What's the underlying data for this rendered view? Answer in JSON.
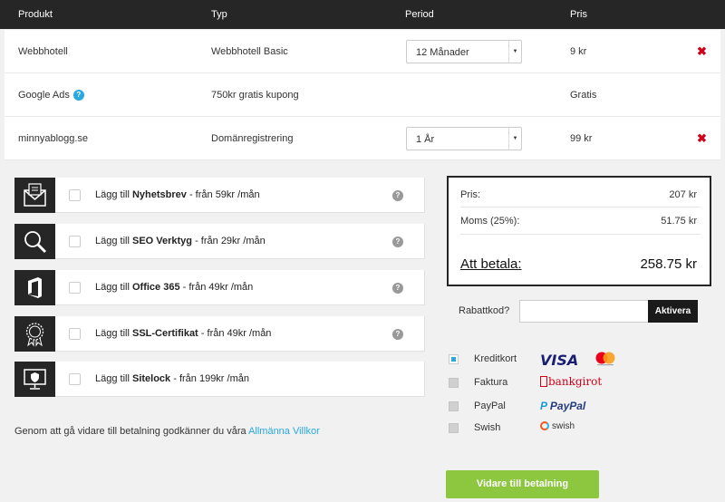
{
  "table": {
    "headers": [
      "Produkt",
      "Typ",
      "Period",
      "Pris"
    ],
    "rows": [
      {
        "product": "Webbhotell",
        "type": "Webbhotell Basic",
        "period": "12 Månader",
        "price": "9 kr"
      },
      {
        "product": "Google Ads",
        "type": "750kr gratis kupong",
        "period": "",
        "price": "Gratis"
      },
      {
        "product": "minnyablogg.se",
        "type": "Domänregistrering",
        "period": "1 År",
        "price": "99 kr"
      }
    ],
    "help_glyph": "?",
    "remove_glyph": "✖",
    "caret_glyph": "▼"
  },
  "addons": [
    {
      "prefix": "Lägg till ",
      "name": "Nyhetsbrev",
      "suffix": " - från 59kr /mån",
      "icon": "newsletter-icon"
    },
    {
      "prefix": "Lägg till ",
      "name": "SEO Verktyg",
      "suffix": " - från 29kr /mån",
      "icon": "seo-magnifier-icon"
    },
    {
      "prefix": "Lägg till ",
      "name": "Office 365",
      "suffix": " - från 49kr /mån",
      "icon": "office-icon"
    },
    {
      "prefix": "Lägg till ",
      "name": "SSL-Certifikat",
      "suffix": " - från 49kr /mån",
      "icon": "ssl-badge-icon"
    },
    {
      "prefix": "Lägg till ",
      "name": "Sitelock",
      "suffix": " - från 199kr /mån",
      "icon": "sitelock-monitor-icon"
    }
  ],
  "summary": {
    "price_label": "Pris:",
    "price_value": "207 kr",
    "vat_label": "Moms (25%):",
    "vat_value": "51.75 kr",
    "total_label": "Att betala:",
    "total_value": "258.75 kr"
  },
  "discount": {
    "label": "Rabattkod?",
    "button": "Aktivera",
    "value": ""
  },
  "payment": [
    {
      "label": "Kreditkort",
      "selected": true,
      "logos": [
        "VISA",
        "mastercard"
      ]
    },
    {
      "label": "Faktura",
      "selected": false,
      "logos": [
        "bankgirot"
      ]
    },
    {
      "label": "PayPal",
      "selected": false,
      "logos": [
        "PayPal"
      ]
    },
    {
      "label": "Swish",
      "selected": false,
      "logos": [
        "swish"
      ]
    }
  ],
  "terms": {
    "text": "Genom att gå vidare till betalning godkänner du våra ",
    "link": "Allmänna Villkor"
  },
  "proceed_button": "Vidare till betalning",
  "colors": {
    "accent": "#29a9e0",
    "dark": "#262626",
    "green": "#8dc63f",
    "remove": "#d0021b"
  }
}
